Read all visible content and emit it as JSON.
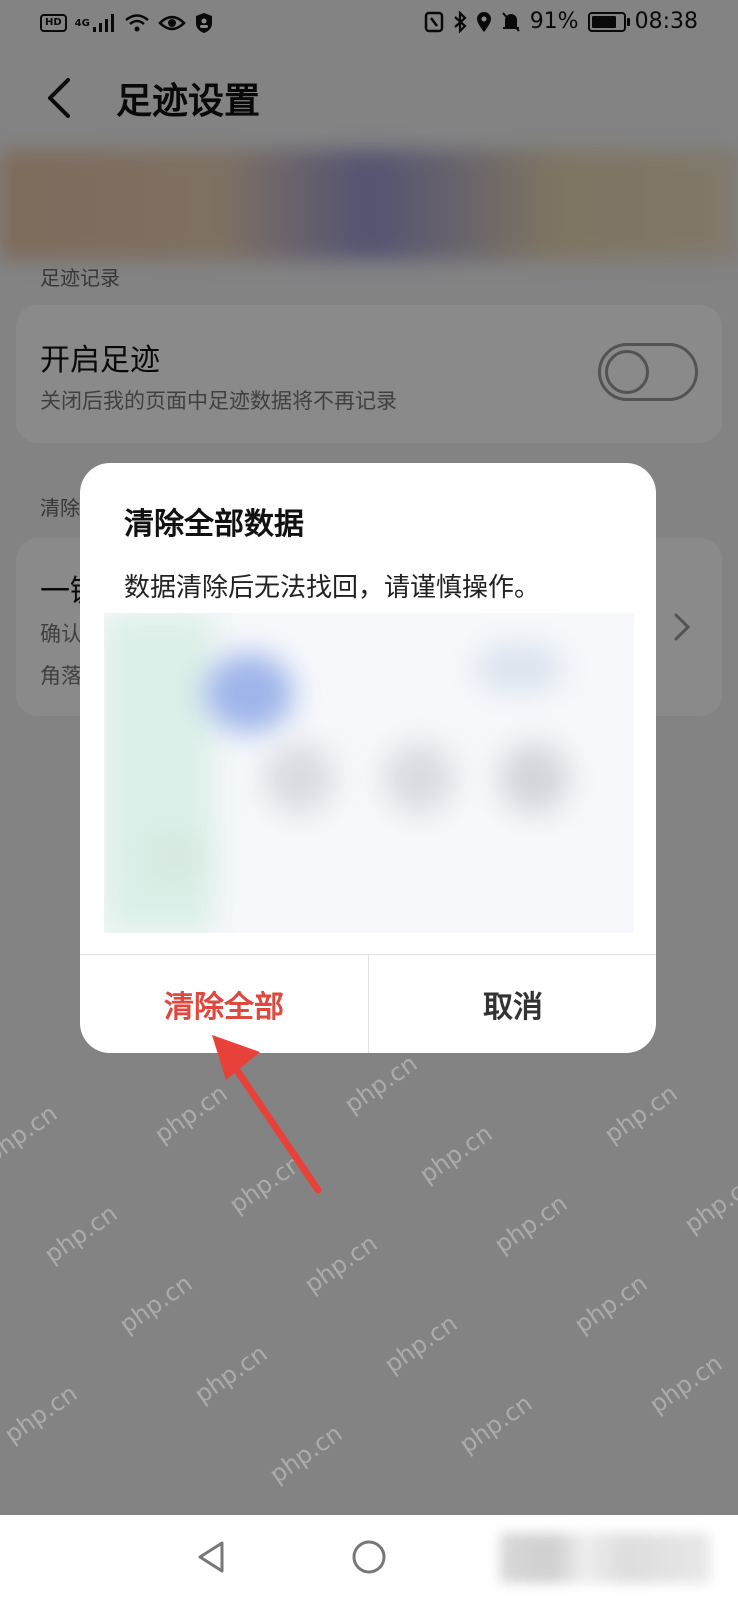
{
  "status_bar": {
    "hd": "HD",
    "network": "4G",
    "battery_percent": "91%",
    "battery_level": 0.91,
    "time": "08:38",
    "icons": [
      "signal-icon",
      "wifi-icon",
      "eye-icon",
      "shield-icon",
      "nfc-icon",
      "bluetooth-icon",
      "location-icon",
      "bell-off-icon",
      "battery-icon"
    ]
  },
  "header": {
    "title": "足迹设置",
    "back_icon": "chevron-left-icon"
  },
  "footprint_section": {
    "label": "足迹记录",
    "toggle_item": {
      "title": "开启足迹",
      "subtitle": "关闭后我的页面中足迹数据将不再记录",
      "enabled": false
    }
  },
  "clear_section": {
    "label_partial": "清除",
    "item_title_partial": "一键",
    "item_sub_partial_1": "确认",
    "item_sub_partial_2": "角落"
  },
  "dialog": {
    "title": "清除全部数据",
    "message": "数据清除后无法找回，请谨慎操作。",
    "confirm_label": "清除全部",
    "cancel_label": "取消",
    "confirm_color": "#e0473d"
  },
  "annotation": {
    "arrow_color": "#e8413a"
  },
  "watermark": {
    "text": "php.cn"
  },
  "nav_bar": {
    "icons": [
      "back-triangle-icon",
      "home-circle-icon"
    ]
  }
}
